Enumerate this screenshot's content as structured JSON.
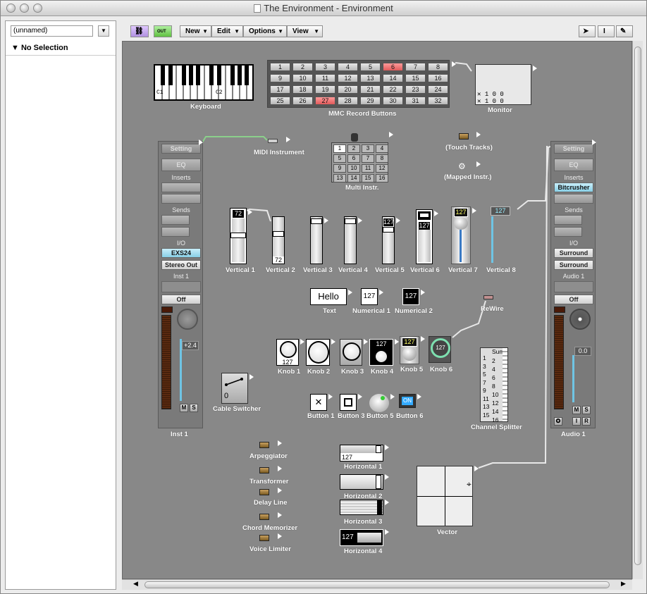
{
  "window": {
    "title": "The Environment - Environment"
  },
  "sidebar": {
    "layer_select": "(unnamed)",
    "no_selection": "No Selection"
  },
  "toolbar": {
    "new": "New",
    "edit": "Edit",
    "options": "Options",
    "view": "View",
    "out_badge": "OUT"
  },
  "keyboard": {
    "label": "Keyboard",
    "c1": "C1",
    "c2": "C2"
  },
  "mmc": {
    "label": "MMC Record Buttons",
    "buttons": [
      "1",
      "2",
      "3",
      "4",
      "5",
      "6",
      "7",
      "8",
      "9",
      "10",
      "11",
      "12",
      "13",
      "14",
      "15",
      "16",
      "17",
      "18",
      "19",
      "20",
      "21",
      "22",
      "23",
      "24",
      "25",
      "26",
      "27",
      "28",
      "29",
      "30",
      "31",
      "32"
    ],
    "active": [
      "6",
      "27"
    ]
  },
  "monitor": {
    "label": "Monitor",
    "row1": "1    0    0",
    "row2": "1    0    0"
  },
  "midi_instrument": {
    "label": "MIDI Instrument"
  },
  "multi_instr": {
    "label": "Multi Instr.",
    "cells": [
      "1",
      "2",
      "3",
      "4",
      "5",
      "6",
      "7",
      "8",
      "9",
      "10",
      "11",
      "12",
      "13",
      "14",
      "15",
      "16"
    ]
  },
  "touch_tracks": {
    "label": "(Touch Tracks)"
  },
  "mapped_instr": {
    "label": "(Mapped Instr.)"
  },
  "strip_left": {
    "setting": "Setting",
    "eq": "EQ",
    "inserts": "Inserts",
    "sends": "Sends",
    "io": "I/O",
    "input": "EXS24",
    "output": "Stereo Out",
    "name_top": "Inst 1",
    "automation": "Off",
    "volume": "+2.4",
    "mute": "M",
    "solo": "S",
    "name_bottom": "Inst 1"
  },
  "strip_right": {
    "setting": "Setting",
    "eq": "EQ",
    "inserts": "Inserts",
    "plugin": "Bitcrusher",
    "sends": "Sends",
    "io": "I/O",
    "input": "Surround",
    "output": "Surround",
    "name_top": "Audio 1",
    "automation": "Off",
    "volume": "0.0",
    "mute": "M",
    "solo": "S",
    "input_mon": "I",
    "rec": "R",
    "name_bottom": "Audio 1"
  },
  "faders": {
    "v1": {
      "label": "Vertical 1",
      "value": "72"
    },
    "v2": {
      "label": "Vertical 2",
      "value": "72"
    },
    "v3": {
      "label": "Vertical 3"
    },
    "v4": {
      "label": "Vertical 4"
    },
    "v5": {
      "label": "Vertical 5",
      "value": "127"
    },
    "v6": {
      "label": "Vertical 6",
      "value": "127"
    },
    "v7": {
      "label": "Vertical 7",
      "value": "127"
    },
    "v8": {
      "label": "Vertical 8",
      "value": "127"
    }
  },
  "text_obj": {
    "label": "Text",
    "value": "Hello"
  },
  "numerical1": {
    "label": "Numerical 1",
    "value": "127"
  },
  "numerical2": {
    "label": "Numerical 2",
    "value": "127"
  },
  "rewire": {
    "label": "ReWire"
  },
  "knobs": {
    "k1": {
      "label": "Knob 1",
      "value": "127"
    },
    "k2": {
      "label": "Knob 2"
    },
    "k3": {
      "label": "Knob 3"
    },
    "k4": {
      "label": "Knob 4",
      "value": "127"
    },
    "k5": {
      "label": "Knob 5",
      "value": "127"
    },
    "k6": {
      "label": "Knob 6",
      "value": "127"
    }
  },
  "cable_switcher": {
    "label": "Cable Switcher",
    "value": "0"
  },
  "buttons": {
    "b1": "Button 1",
    "b3": "Button 3",
    "b5": "Button 5",
    "b6": "Button 6",
    "on": "ON"
  },
  "channel_splitter": {
    "label": "Channel Splitter",
    "sum": "Sum",
    "left": [
      "1",
      "3",
      "5",
      "7",
      "9",
      "11",
      "13",
      "15"
    ],
    "right": [
      "2",
      "4",
      "6",
      "8",
      "10",
      "12",
      "14",
      "16"
    ]
  },
  "modules": {
    "arpeggiator": "Arpeggiator",
    "transformer": "Transformer",
    "delay_line": "Delay Line",
    "chord_memorizer": "Chord Memorizer",
    "voice_limiter": "Voice Limiter"
  },
  "horizontals": {
    "h1": {
      "label": "Horizontal 1",
      "value": "127"
    },
    "h2": {
      "label": "Horizontal 2"
    },
    "h3": {
      "label": "Horizontal 3"
    },
    "h4": {
      "label": "Horizontal 4",
      "value": "127"
    }
  },
  "vector": {
    "label": "Vector"
  }
}
